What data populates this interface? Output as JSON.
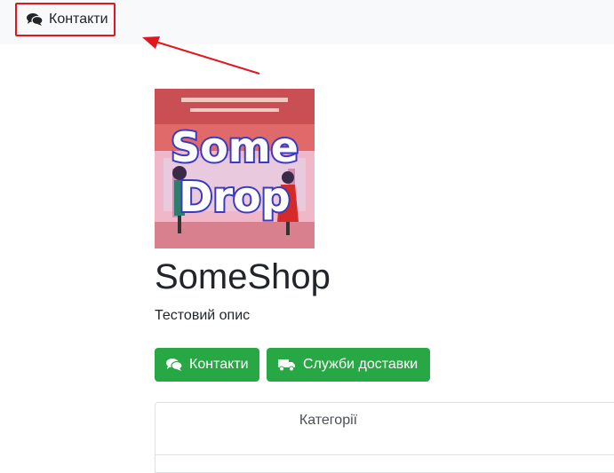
{
  "nav": {
    "contacts_label": "Контакти",
    "contacts_icon": "comments-icon"
  },
  "shop": {
    "logo_text_line1": "Some",
    "logo_text_line2": "Drop",
    "name": "SomeShop",
    "description": "Тестовий опис"
  },
  "actions": {
    "contacts_label": "Контакти",
    "delivery_label": "Служби доставки",
    "accent": "#28a745"
  },
  "card": {
    "header": "Категорії"
  },
  "colors": {
    "highlight": "#e3161f",
    "topbar": "#f8f9fa"
  }
}
